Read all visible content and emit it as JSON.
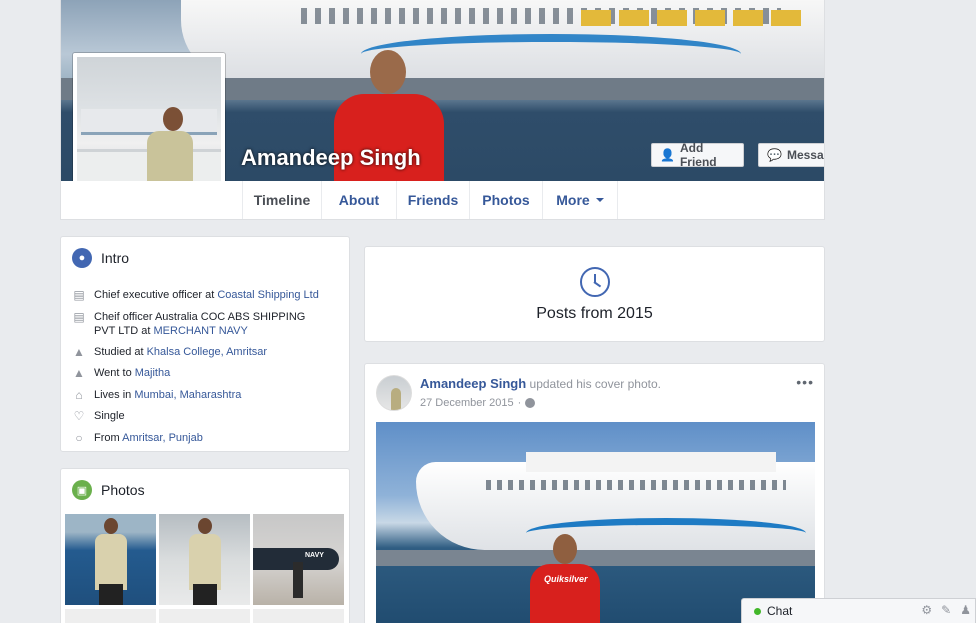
{
  "profile": {
    "name": "Amandeep Singh"
  },
  "cover_actions": {
    "add_friend": "Add Friend",
    "message": "Message",
    "more": "•••"
  },
  "tabs": [
    {
      "label": "Timeline"
    },
    {
      "label": "About"
    },
    {
      "label": "Friends"
    },
    {
      "label": "Photos"
    },
    {
      "label": "More"
    }
  ],
  "intro": {
    "title": "Intro",
    "items": [
      {
        "icon": "briefcase-icon",
        "prefix": "Chief executive officer at ",
        "link": "Coastal Shipping Ltd"
      },
      {
        "icon": "briefcase-icon",
        "prefix": "Cheif officer Australia COC ABS SHIPPING PVT LTD at ",
        "link": "MERCHANT NAVY"
      },
      {
        "icon": "graduation-cap-icon",
        "prefix": "Studied at ",
        "link": "Khalsa College, Amritsar"
      },
      {
        "icon": "graduation-cap-icon",
        "prefix": "Went to ",
        "link": "Majitha"
      },
      {
        "icon": "home-icon",
        "prefix": "Lives in ",
        "link": "Mumbai, Maharashtra"
      },
      {
        "icon": "heart-icon",
        "prefix": "Single",
        "link": ""
      },
      {
        "icon": "location-pin-icon",
        "prefix": "From ",
        "link": "Amritsar, Punjab"
      }
    ]
  },
  "photos_card": {
    "title": "Photos",
    "thumb3_label": "NAVY"
  },
  "posts_from": {
    "title": "Posts from 2015"
  },
  "post": {
    "author": "Amandeep Singh",
    "action": "updated his cover photo.",
    "date": "27 December 2015",
    "separator": "·",
    "more": "•••",
    "image_text": "Quiksilver"
  },
  "chat": {
    "label": "Chat"
  },
  "colors": {
    "link": "#365899",
    "intro_icon": "#4267b2",
    "photos_icon": "#6ab04c",
    "online": "#42b72a"
  }
}
